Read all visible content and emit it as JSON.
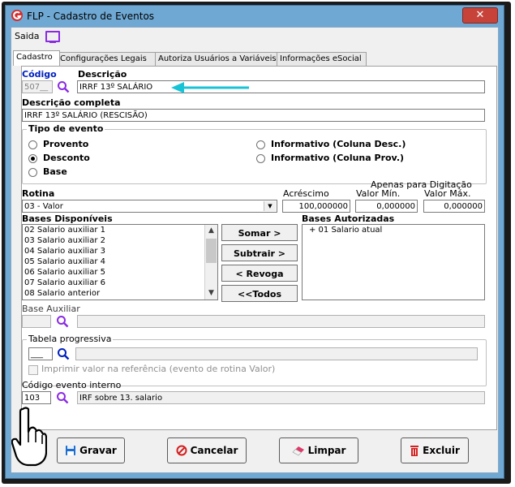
{
  "window": {
    "title": "FLP - Cadastro de Eventos",
    "close_glyph": "✕"
  },
  "menu": {
    "saida": "Saida"
  },
  "tabs": [
    "Cadastro",
    "Configurações Legais",
    "Autoriza Usuários a Variáveis",
    "Informações eSocial"
  ],
  "codigo": {
    "label": "Código",
    "value": "507__"
  },
  "descricao": {
    "label": "Descrição",
    "value": "IRRF 13º SALÁRIO"
  },
  "descricao_completa": {
    "label": "Descrição completa",
    "value": "IRRF 13º SALÁRIO (RESCISÃO)"
  },
  "tipo_evento": {
    "label": "Tipo de evento",
    "options": [
      "Provento",
      "Desconto",
      "Base",
      "Informativo (Coluna Desc.)",
      "Informativo (Coluna Prov.)"
    ],
    "selected": "Desconto"
  },
  "rotina": {
    "label": "Rotina",
    "value": "03 - Valor"
  },
  "apenas_digitacao": "Apenas para Digitação",
  "acrescimo": {
    "label": "Acréscimo",
    "value": "100,000000"
  },
  "valor_min": {
    "label": "Valor Mín.",
    "value": "0,000000"
  },
  "valor_max": {
    "label": "Valor Máx.",
    "value": "0,000000"
  },
  "bases_disponiveis": {
    "label": "Bases Disponíveis",
    "items": [
      "02 Salario auxiliar 1",
      "03 Salario auxiliar 2",
      "04 Salario auxiliar 3",
      "05 Salario auxiliar 4",
      "06 Salario auxiliar 5",
      "07 Salario auxiliar 6",
      "08 Salario anterior"
    ]
  },
  "bases_autorizadas": {
    "label": "Bases Autorizadas",
    "items": [
      "+ 01 Salario atual"
    ]
  },
  "move_buttons": {
    "somar": "Somar >",
    "subtrair": "Subtrair >",
    "revoga": "< Revoga",
    "todos": "<<Todos"
  },
  "base_auxiliar": {
    "label": "Base Auxiliar"
  },
  "tabela_progressiva": {
    "label": "Tabela progressiva",
    "value": "___"
  },
  "imprimir": {
    "label": "Imprimir valor na referência (evento de rotina Valor)"
  },
  "codigo_interno": {
    "label": "Código evento interno",
    "value": "103",
    "description": "IRF sobre 13. salario"
  },
  "actions": {
    "gravar": "Gravar",
    "cancelar": "Cancelar",
    "limpar": "Limpar",
    "excluir": "Excluir"
  },
  "colors": {
    "accent_blue": "#0020c0",
    "search_purple": "#8a2be2",
    "arrow_cyan": "#19c3d6",
    "title_bar": "#6fa8d3",
    "close_red": "#c7433a"
  },
  "icons": [
    "g-logo-icon",
    "monitor-icon",
    "search-icon",
    "floppy-disk-icon",
    "cancel-icon",
    "eraser-icon",
    "trash-icon",
    "hand-cursor-icon",
    "arrow-pointer-icon"
  ]
}
